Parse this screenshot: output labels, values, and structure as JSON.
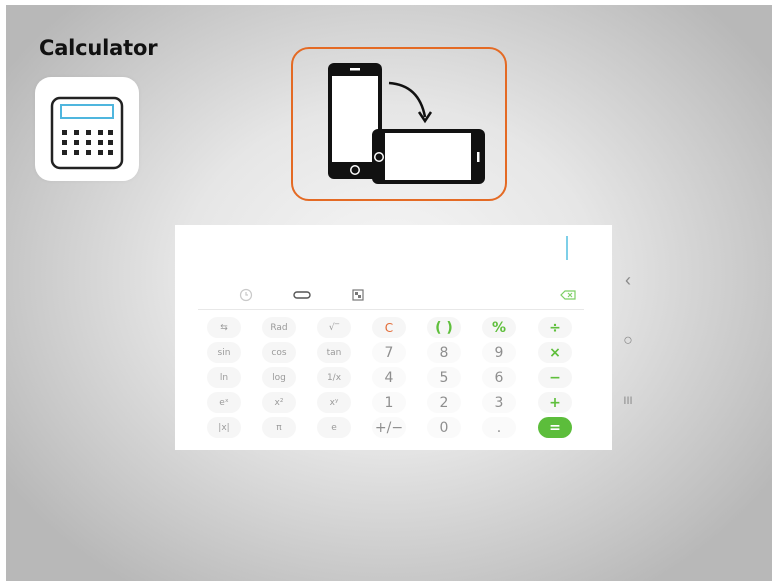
{
  "title": "Calculator",
  "calc": {
    "tools": [
      {
        "name": "history-icon"
      },
      {
        "name": "unit-converter-icon"
      },
      {
        "name": "scientific-toggle-icon"
      },
      {
        "name": "backspace-icon"
      }
    ],
    "keys": [
      [
        "⇆",
        "Rad",
        "√‾",
        "C",
        "( )",
        "%",
        "÷"
      ],
      [
        "sin",
        "cos",
        "tan",
        "7",
        "8",
        "9",
        "×"
      ],
      [
        "ln",
        "log",
        "1/x",
        "4",
        "5",
        "6",
        "−"
      ],
      [
        "eˣ",
        "x²",
        "xʸ",
        "1",
        "2",
        "3",
        "+"
      ],
      [
        "|x|",
        "π",
        "e",
        "+/−",
        "0",
        ".",
        "="
      ]
    ]
  },
  "nav": {
    "back": "‹",
    "home": "○",
    "recents": "III"
  },
  "colors": {
    "accent_green": "#5cbd3b",
    "clear_orange": "#e36b36",
    "box_orange": "#e46a24"
  }
}
